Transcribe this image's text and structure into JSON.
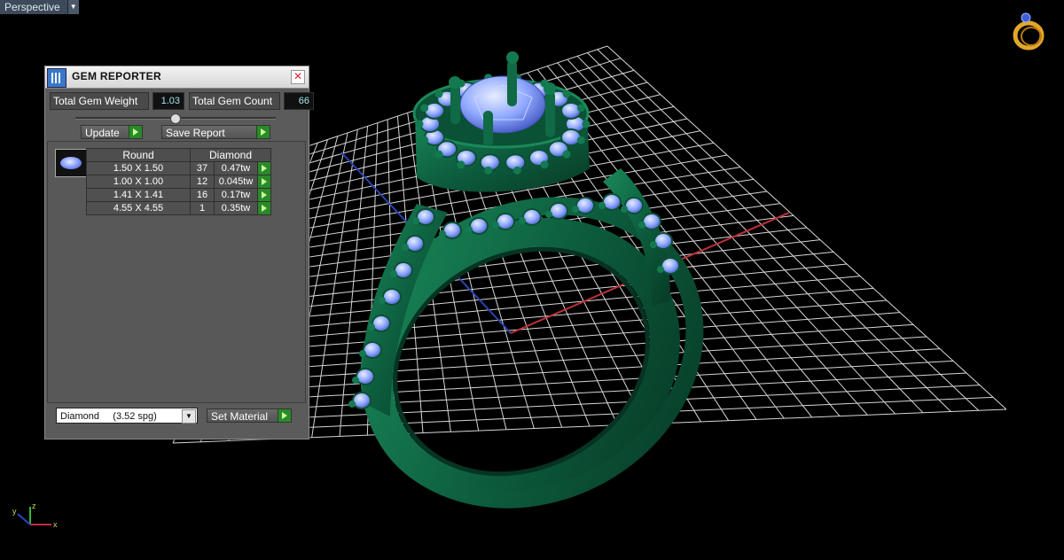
{
  "view": {
    "label": "Perspective",
    "dropdown_icon": "chevron-down-icon"
  },
  "dialog": {
    "title": "GEM REPORTER",
    "close_icon": "close-icon",
    "totals": {
      "weight_label": "Total Gem Weight",
      "weight_value": "1.03",
      "count_label": "Total Gem Count",
      "count_value": "66"
    },
    "update_label": "Update",
    "save_report_label": "Save Report",
    "table": {
      "headers": [
        "Round",
        "Diamond"
      ],
      "rows": [
        {
          "size": "1.50 X 1.50",
          "count": "37",
          "weight": "0.47tw"
        },
        {
          "size": "1.00 X 1.00",
          "count": "12",
          "weight": "0.045tw"
        },
        {
          "size": "1.41 X 1.41",
          "count": "16",
          "weight": "0.17tw"
        },
        {
          "size": "4.55 X 4.55",
          "count": "1",
          "weight": "0.35tw"
        }
      ]
    },
    "material": {
      "selected": "Diamond     (3.52 spg)"
    },
    "set_material_label": "Set Material"
  },
  "axis": {
    "x": "x",
    "y": "y",
    "z": "z"
  },
  "colors": {
    "ring_green": "#0d5e3e",
    "gem_blue": "#8fa8ff",
    "grid": "#d8d8d8",
    "x_axis": "#c0303a",
    "y_axis": "#2840a8"
  }
}
